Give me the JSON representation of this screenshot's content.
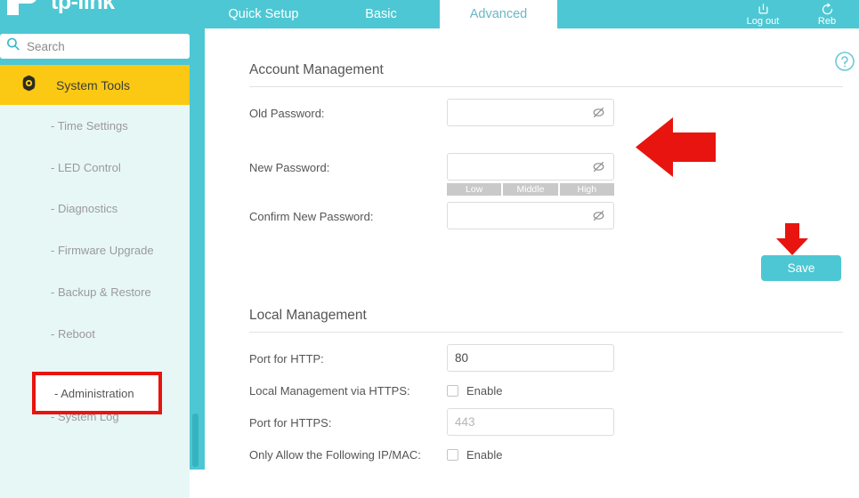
{
  "brand": {
    "name": "tp-link",
    "logo_icon": "tp-link-logo"
  },
  "topbar": {
    "tabs": [
      {
        "label": "Quick Setup",
        "active": false
      },
      {
        "label": "Basic",
        "active": false
      },
      {
        "label": "Advanced",
        "active": true
      }
    ],
    "actions": [
      {
        "label": "Log out",
        "icon": "logout-icon"
      },
      {
        "label": "Reb",
        "icon": "reboot-icon"
      }
    ],
    "background_color": "#4dc7d3"
  },
  "sidebar": {
    "search": {
      "placeholder": "Search",
      "icon": "search-icon"
    },
    "category": {
      "label": "System Tools",
      "icon": "gear-icon",
      "background_color": "#fbc913"
    },
    "items": [
      {
        "label": "- Time Settings",
        "highlighted": false
      },
      {
        "label": "- LED Control",
        "highlighted": false
      },
      {
        "label": "- Diagnostics",
        "highlighted": false
      },
      {
        "label": "- Firmware Upgrade",
        "highlighted": false
      },
      {
        "label": "- Backup & Restore",
        "highlighted": false
      },
      {
        "label": "- Reboot",
        "highlighted": false
      },
      {
        "label": "- Administration",
        "highlighted": true
      },
      {
        "label": "- System Log",
        "highlighted": false
      }
    ],
    "annotation_color": "#e8140f"
  },
  "account_management": {
    "title": "Account Management",
    "fields": [
      {
        "label": "Old Password:",
        "value": "",
        "icon": "eye-off-icon"
      },
      {
        "label": "New Password:",
        "value": "",
        "icon": "eye-off-icon"
      },
      {
        "label": "Confirm New Password:",
        "value": "",
        "icon": "eye-off-icon"
      }
    ],
    "strength": {
      "segments": [
        "Low",
        "Middle",
        "High"
      ]
    },
    "save_label": "Save"
  },
  "local_management": {
    "title": "Local Management",
    "http_port": {
      "label": "Port for HTTP:",
      "value": "80"
    },
    "https_toggle": {
      "label": "Local Management via HTTPS:",
      "checkbox_label": "Enable",
      "checked": false
    },
    "https_port": {
      "label": "Port for HTTPS:",
      "value": "443"
    },
    "ip_mac_filter": {
      "label": "Only Allow the Following IP/MAC:",
      "checkbox_label": "Enable",
      "checked": false
    }
  },
  "help": {
    "icon": "help-circle-icon"
  },
  "annotations": {
    "arrow_left": {
      "icon": "arrow-left-annotation",
      "color": "#e8140f"
    },
    "arrow_down": {
      "icon": "arrow-down-annotation",
      "color": "#e8140f"
    }
  }
}
